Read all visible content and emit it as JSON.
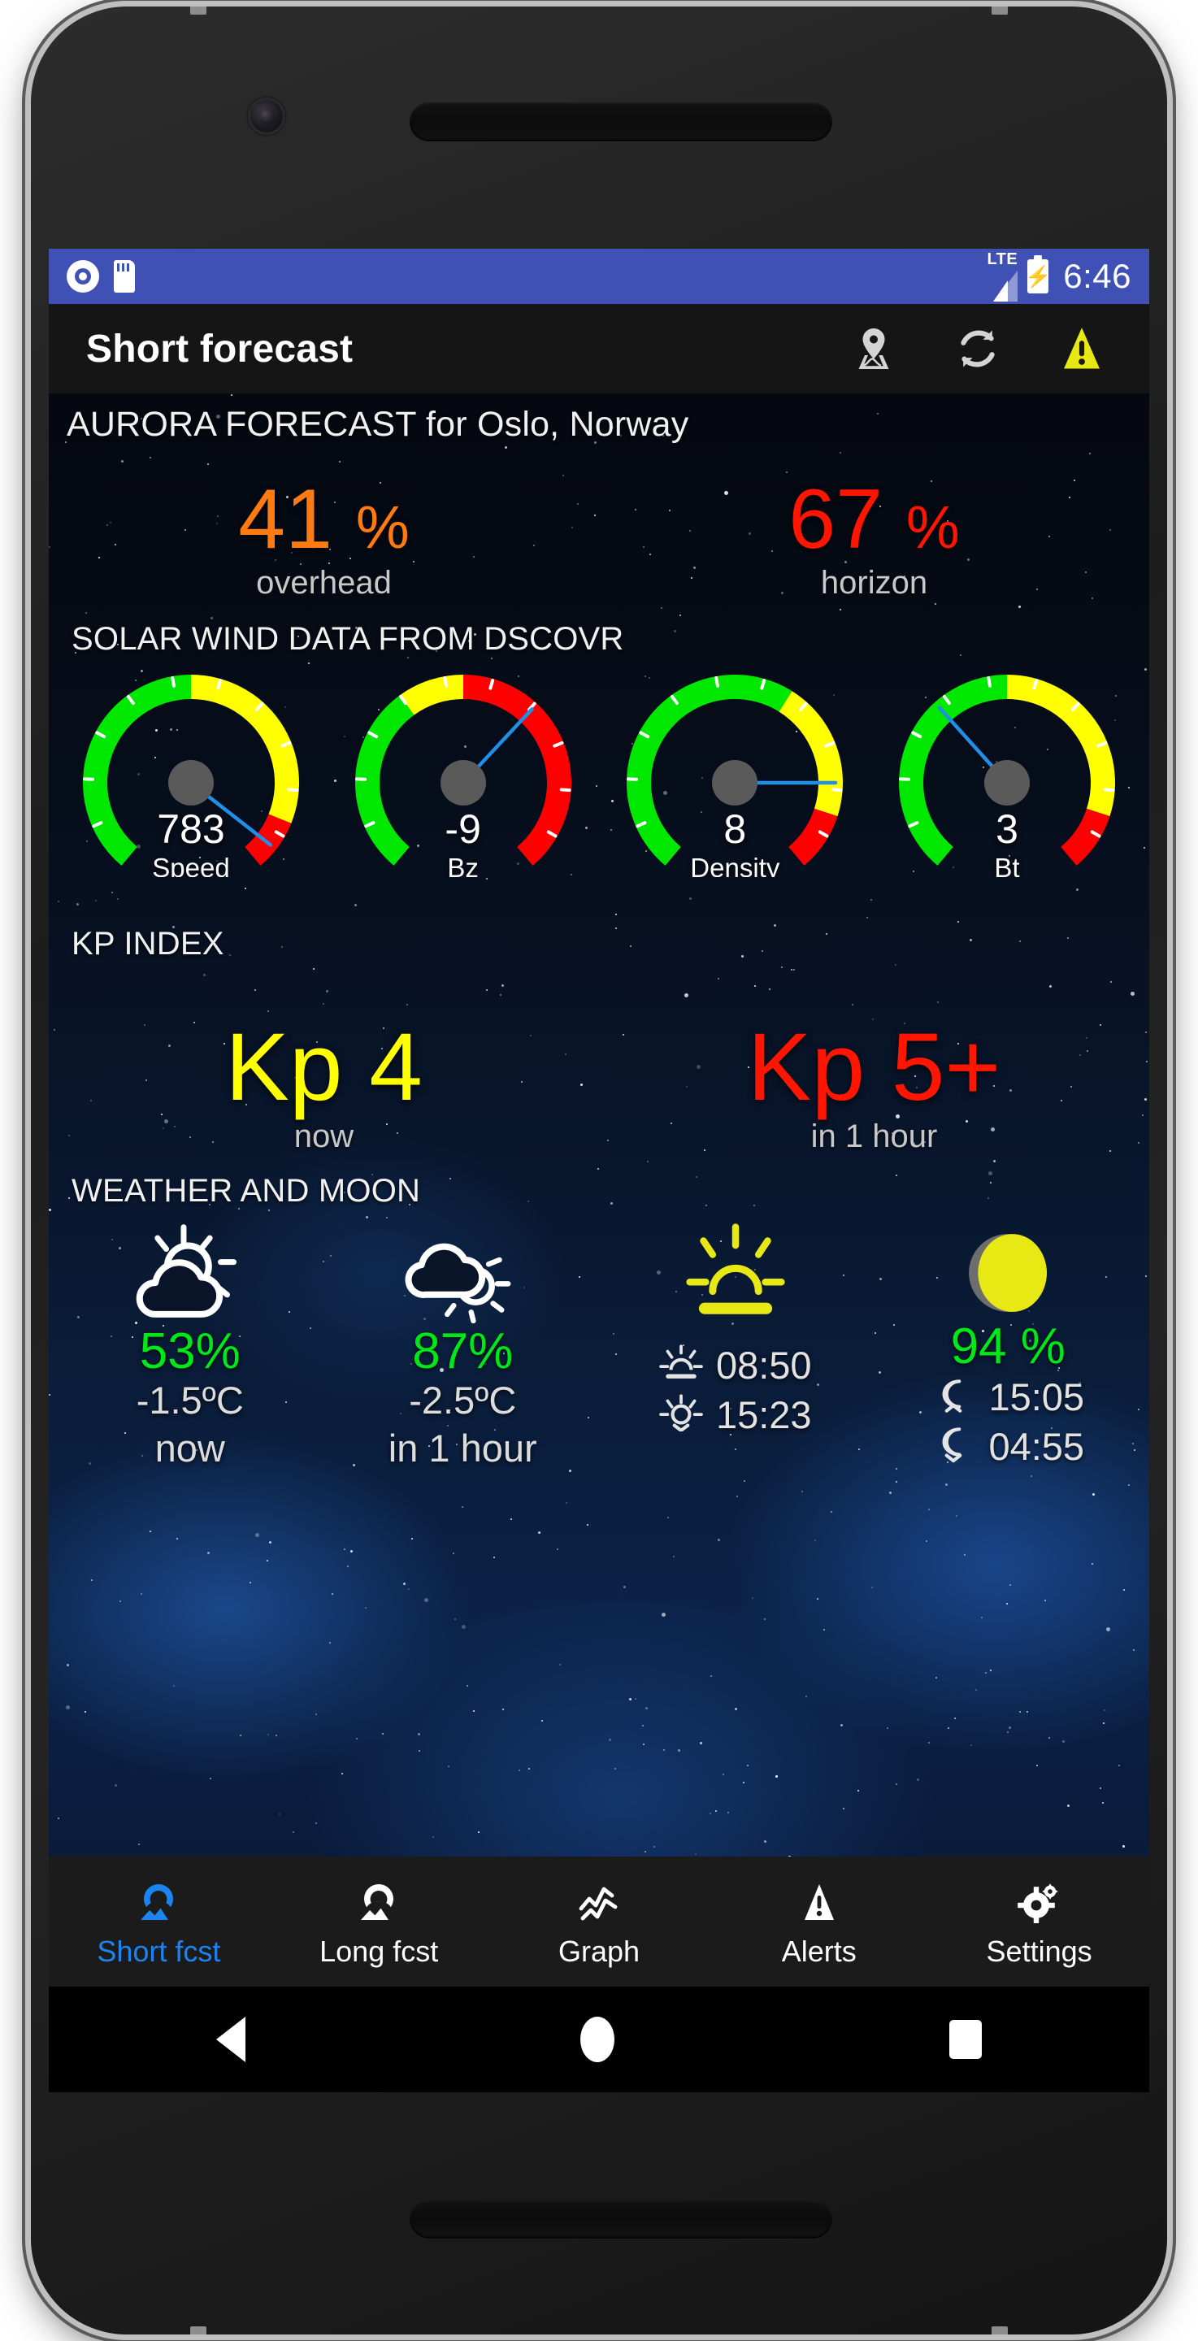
{
  "status_bar": {
    "time": "6:46",
    "network_label": "LTE",
    "icons": [
      "record-icon",
      "sd-card-icon",
      "signal-icon",
      "battery-charging-icon"
    ]
  },
  "app_bar": {
    "title": "Short forecast",
    "actions": [
      {
        "name": "map-pin-icon",
        "label": "Map"
      },
      {
        "name": "refresh-icon",
        "label": "Refresh"
      },
      {
        "name": "warning-icon",
        "label": "Alerts"
      }
    ]
  },
  "aurora": {
    "heading": "AURORA FORECAST for Oslo, Norway",
    "overhead": {
      "value": "41",
      "unit": "%",
      "label": "overhead",
      "color": "#ff7a10"
    },
    "horizon": {
      "value": "67",
      "unit": "%",
      "label": "horizon",
      "color": "#ff1500"
    }
  },
  "solar_wind": {
    "heading": "SOLAR WIND DATA FROM DSCOVR",
    "gauges": [
      {
        "value": "783",
        "label": "Speed"
      },
      {
        "value": "-9",
        "label": "Bz"
      },
      {
        "value": "8",
        "label": "Density"
      },
      {
        "value": "3",
        "label": "Bt"
      }
    ]
  },
  "kp_index": {
    "heading": "KP INDEX",
    "now": {
      "value": "Kp 4",
      "label": "now",
      "color": "#ffff00"
    },
    "next": {
      "value": "Kp 5+",
      "label": "in 1 hour",
      "color": "#ff1500"
    }
  },
  "weather_moon": {
    "heading": "WEATHER AND MOON",
    "now": {
      "icon": "partly-cloudy-icon",
      "percent": "53%",
      "temp": "-1.5ºC",
      "when": "now"
    },
    "next": {
      "icon": "cloudy-sun-icon",
      "percent": "87%",
      "temp": "-2.5ºC",
      "when": "in 1 hour"
    },
    "sun": {
      "icon": "sunrise-sunset-icon",
      "rise_icon": "sunrise-icon",
      "rise": "08:50",
      "set_icon": "sunset-icon",
      "set": "15:23"
    },
    "moon": {
      "icon": "moon-phase-icon",
      "percent": "94 %",
      "rise_icon": "moonrise-icon",
      "rise": "15:05",
      "set_icon": "moonset-icon",
      "set": "04:55"
    }
  },
  "bottom_nav": {
    "active_color": "#1b84f0",
    "items": [
      {
        "icon": "aurora-short-icon",
        "label": "Short fcst",
        "active": true
      },
      {
        "icon": "aurora-long-icon",
        "label": "Long fcst",
        "active": false
      },
      {
        "icon": "graph-icon",
        "label": "Graph",
        "active": false
      },
      {
        "icon": "alert-triangle-icon",
        "label": "Alerts",
        "active": false
      },
      {
        "icon": "gear-icon",
        "label": "Settings",
        "active": false
      }
    ]
  },
  "android_nav": {
    "back": "back-button",
    "home": "home-button",
    "recents": "recents-button"
  },
  "chart_data": {
    "type": "bar",
    "title": "SOLAR WIND DATA FROM DSCOVR",
    "categories": [
      "Speed",
      "Bz",
      "Density",
      "Bt"
    ],
    "values": [
      783,
      -9,
      8,
      3
    ],
    "needle_angles_deg": [
      128,
      43,
      90,
      -42
    ],
    "zones": [
      {
        "name": "Speed",
        "green_end_deg": 0,
        "yellow_end_deg": 112,
        "red_end_deg": 140
      },
      {
        "name": "Bz",
        "green_end_deg": -36,
        "yellow_end_deg": 0,
        "red_end_deg": 140
      },
      {
        "name": "Density",
        "green_end_deg": 32,
        "yellow_end_deg": 108,
        "red_end_deg": 140
      },
      {
        "name": "Bt",
        "green_end_deg": 0,
        "yellow_end_deg": 108,
        "red_end_deg": 140
      }
    ],
    "colors": {
      "green": "#00e800",
      "yellow": "#ffff00",
      "red": "#ff0000",
      "needle": "#1f8fe8",
      "hub": "#5a5a5a"
    },
    "xlabel": "",
    "ylabel": ""
  }
}
